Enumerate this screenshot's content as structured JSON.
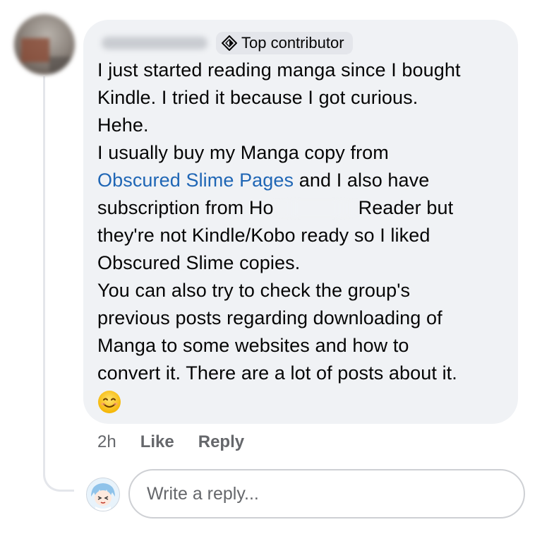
{
  "comment": {
    "badge_label": "Top contributor",
    "badge_icon": "diamond-badge-icon",
    "lines": [
      {
        "text": "I just started reading manga since I bought"
      },
      {
        "text": "Kindle. I tried it because I got curious."
      },
      {
        "text": "Hehe."
      },
      {
        "text": "I usually buy my Manga copy from"
      }
    ],
    "link_text": "Obscured Slime Pages",
    "after_link": " and I also have",
    "sub_line_start": "subscription from Ho",
    "sub_line_end": "Reader but",
    "lines2": [
      {
        "text": "they're not Kindle/Kobo ready so I liked"
      },
      {
        "text": "Obscured Slime copies."
      },
      {
        "text": "You can also try to check the group's"
      },
      {
        "text": "previous posts regarding downloading of"
      },
      {
        "text": "Manga to some websites and how to"
      },
      {
        "text": "convert it. There are a lot of posts about it."
      }
    ],
    "emoji": "smiling-face-emoji"
  },
  "actions": {
    "time": "2h",
    "like_label": "Like",
    "reply_label": "Reply"
  },
  "reply_box": {
    "placeholder": "Write a reply..."
  },
  "colors": {
    "bubble_bg": "#f0f2f5",
    "link": "#1f66b5",
    "meta": "#65676b",
    "text": "#050505"
  }
}
